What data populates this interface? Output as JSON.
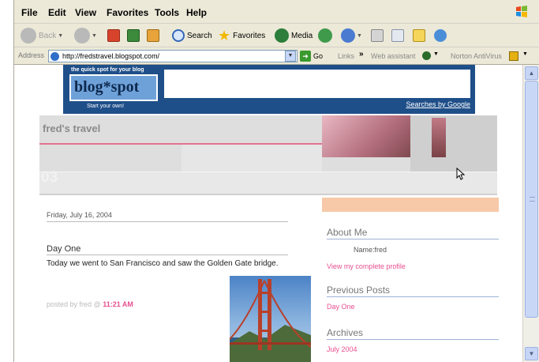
{
  "menu": {
    "items": [
      "File",
      "Edit",
      "View",
      "Favorites",
      "Tools",
      "Help"
    ]
  },
  "toolbar": {
    "back_label": "Back",
    "search_label": "Search",
    "favorites_label": "Favorites",
    "media_label": "Media"
  },
  "address": {
    "label": "Address",
    "url": "http://fredstravel.blogspot.com/",
    "go_label": "Go",
    "links_label": "Links",
    "links_chevron": "»",
    "web_assistant_label": "Web assistant",
    "norton_label": "Norton AntiVirus"
  },
  "banner": {
    "tagline": "the quick spot for your blog",
    "logo_text": "blog*spot",
    "start_label": "Start your own!",
    "search_link": "Searches by Google"
  },
  "blog": {
    "title": "fred's travel",
    "header_number": "03"
  },
  "post": {
    "date": "Friday, July 16, 2004",
    "title": "Day One",
    "body": "Today we went to San Francisco and saw the Golden Gate bridge.",
    "footer_prefix": "posted by fred @",
    "time": "11:21 AM"
  },
  "sidebar": {
    "about_heading": "About Me",
    "name_line": "Name:fred",
    "profile_link": "View my complete profile",
    "previous_heading": "Previous Posts",
    "previous_items": [
      "Day One"
    ],
    "archives_heading": "Archives",
    "archive_items": [
      "July 2004"
    ]
  },
  "colors": {
    "banner_blue": "#1f4f89",
    "link_pink": "#e84f8f",
    "rule_blue": "#9fb2d6",
    "header_gray": "#dedede"
  },
  "icons": [
    "xp-flag-icon",
    "back-arrow-icon",
    "forward-arrow-icon",
    "stop-icon",
    "refresh-icon",
    "home-icon",
    "search-icon",
    "favorites-star-icon",
    "media-icon",
    "history-icon",
    "mail-icon",
    "print-icon",
    "edit-icon",
    "folder-icon",
    "messenger-icon",
    "go-arrow-icon",
    "web-assistant-icon",
    "norton-icon",
    "mouse-pointer-icon"
  ]
}
